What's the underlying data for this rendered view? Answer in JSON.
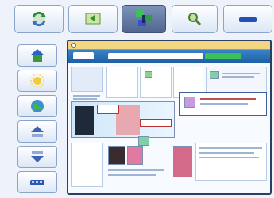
{
  "toolbar": {
    "buttons": [
      {
        "name": "refresh-arrows-icon",
        "label": ""
      },
      {
        "name": "screen-back-icon",
        "label": ""
      },
      {
        "name": "network-connection-icon",
        "label": ""
      },
      {
        "name": "magnifier-zoom-icon",
        "label": ""
      },
      {
        "name": "minimize-bar-icon",
        "label": ""
      }
    ],
    "active_index": 2
  },
  "sidebar": {
    "buttons": [
      {
        "name": "home-icon",
        "label": ""
      },
      {
        "name": "sun-settings-icon",
        "label": ""
      },
      {
        "name": "globe-icon",
        "label": ""
      },
      {
        "name": "scroll-up-icon",
        "label": ""
      },
      {
        "name": "scroll-down-icon",
        "label": ""
      },
      {
        "name": "keyboard-icon",
        "label": ""
      }
    ]
  },
  "browser": {
    "title": ""
  },
  "colors": {
    "accent": "#2b3e66",
    "toolbar_active": "#4f6690",
    "nav_blue": "#1f5fa5",
    "go_green": "#3cc05b"
  }
}
